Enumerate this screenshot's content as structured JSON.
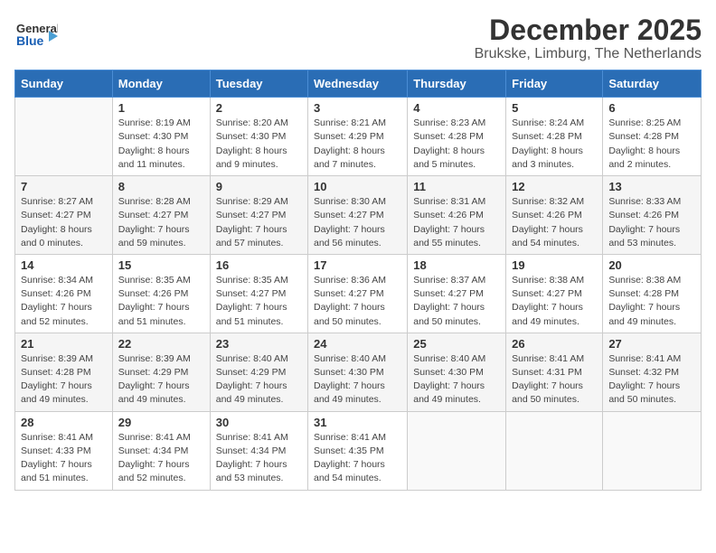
{
  "header": {
    "logo_general": "General",
    "logo_blue": "Blue",
    "title": "December 2025",
    "subtitle": "Brukske, Limburg, The Netherlands"
  },
  "days_of_week": [
    "Sunday",
    "Monday",
    "Tuesday",
    "Wednesday",
    "Thursday",
    "Friday",
    "Saturday"
  ],
  "weeks": [
    [
      {
        "day": "",
        "info": ""
      },
      {
        "day": "1",
        "info": "Sunrise: 8:19 AM\nSunset: 4:30 PM\nDaylight: 8 hours\nand 11 minutes."
      },
      {
        "day": "2",
        "info": "Sunrise: 8:20 AM\nSunset: 4:30 PM\nDaylight: 8 hours\nand 9 minutes."
      },
      {
        "day": "3",
        "info": "Sunrise: 8:21 AM\nSunset: 4:29 PM\nDaylight: 8 hours\nand 7 minutes."
      },
      {
        "day": "4",
        "info": "Sunrise: 8:23 AM\nSunset: 4:28 PM\nDaylight: 8 hours\nand 5 minutes."
      },
      {
        "day": "5",
        "info": "Sunrise: 8:24 AM\nSunset: 4:28 PM\nDaylight: 8 hours\nand 3 minutes."
      },
      {
        "day": "6",
        "info": "Sunrise: 8:25 AM\nSunset: 4:28 PM\nDaylight: 8 hours\nand 2 minutes."
      }
    ],
    [
      {
        "day": "7",
        "info": "Sunrise: 8:27 AM\nSunset: 4:27 PM\nDaylight: 8 hours\nand 0 minutes."
      },
      {
        "day": "8",
        "info": "Sunrise: 8:28 AM\nSunset: 4:27 PM\nDaylight: 7 hours\nand 59 minutes."
      },
      {
        "day": "9",
        "info": "Sunrise: 8:29 AM\nSunset: 4:27 PM\nDaylight: 7 hours\nand 57 minutes."
      },
      {
        "day": "10",
        "info": "Sunrise: 8:30 AM\nSunset: 4:27 PM\nDaylight: 7 hours\nand 56 minutes."
      },
      {
        "day": "11",
        "info": "Sunrise: 8:31 AM\nSunset: 4:26 PM\nDaylight: 7 hours\nand 55 minutes."
      },
      {
        "day": "12",
        "info": "Sunrise: 8:32 AM\nSunset: 4:26 PM\nDaylight: 7 hours\nand 54 minutes."
      },
      {
        "day": "13",
        "info": "Sunrise: 8:33 AM\nSunset: 4:26 PM\nDaylight: 7 hours\nand 53 minutes."
      }
    ],
    [
      {
        "day": "14",
        "info": "Sunrise: 8:34 AM\nSunset: 4:26 PM\nDaylight: 7 hours\nand 52 minutes."
      },
      {
        "day": "15",
        "info": "Sunrise: 8:35 AM\nSunset: 4:26 PM\nDaylight: 7 hours\nand 51 minutes."
      },
      {
        "day": "16",
        "info": "Sunrise: 8:35 AM\nSunset: 4:27 PM\nDaylight: 7 hours\nand 51 minutes."
      },
      {
        "day": "17",
        "info": "Sunrise: 8:36 AM\nSunset: 4:27 PM\nDaylight: 7 hours\nand 50 minutes."
      },
      {
        "day": "18",
        "info": "Sunrise: 8:37 AM\nSunset: 4:27 PM\nDaylight: 7 hours\nand 50 minutes."
      },
      {
        "day": "19",
        "info": "Sunrise: 8:38 AM\nSunset: 4:27 PM\nDaylight: 7 hours\nand 49 minutes."
      },
      {
        "day": "20",
        "info": "Sunrise: 8:38 AM\nSunset: 4:28 PM\nDaylight: 7 hours\nand 49 minutes."
      }
    ],
    [
      {
        "day": "21",
        "info": "Sunrise: 8:39 AM\nSunset: 4:28 PM\nDaylight: 7 hours\nand 49 minutes."
      },
      {
        "day": "22",
        "info": "Sunrise: 8:39 AM\nSunset: 4:29 PM\nDaylight: 7 hours\nand 49 minutes."
      },
      {
        "day": "23",
        "info": "Sunrise: 8:40 AM\nSunset: 4:29 PM\nDaylight: 7 hours\nand 49 minutes."
      },
      {
        "day": "24",
        "info": "Sunrise: 8:40 AM\nSunset: 4:30 PM\nDaylight: 7 hours\nand 49 minutes."
      },
      {
        "day": "25",
        "info": "Sunrise: 8:40 AM\nSunset: 4:30 PM\nDaylight: 7 hours\nand 49 minutes."
      },
      {
        "day": "26",
        "info": "Sunrise: 8:41 AM\nSunset: 4:31 PM\nDaylight: 7 hours\nand 50 minutes."
      },
      {
        "day": "27",
        "info": "Sunrise: 8:41 AM\nSunset: 4:32 PM\nDaylight: 7 hours\nand 50 minutes."
      }
    ],
    [
      {
        "day": "28",
        "info": "Sunrise: 8:41 AM\nSunset: 4:33 PM\nDaylight: 7 hours\nand 51 minutes."
      },
      {
        "day": "29",
        "info": "Sunrise: 8:41 AM\nSunset: 4:34 PM\nDaylight: 7 hours\nand 52 minutes."
      },
      {
        "day": "30",
        "info": "Sunrise: 8:41 AM\nSunset: 4:34 PM\nDaylight: 7 hours\nand 53 minutes."
      },
      {
        "day": "31",
        "info": "Sunrise: 8:41 AM\nSunset: 4:35 PM\nDaylight: 7 hours\nand 54 minutes."
      },
      {
        "day": "",
        "info": ""
      },
      {
        "day": "",
        "info": ""
      },
      {
        "day": "",
        "info": ""
      }
    ]
  ]
}
